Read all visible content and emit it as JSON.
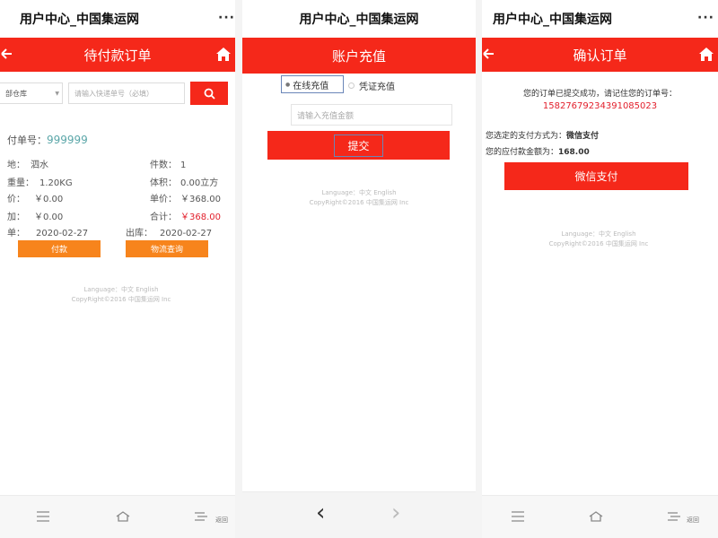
{
  "colors": {
    "brand_red": "#f5281a",
    "orange": "#f7841c",
    "order_red": "#e2202c",
    "order_teal": "#5aa6a8"
  },
  "panel1": {
    "window_title": "用户中心_中国集运网",
    "more_label": "···",
    "header": "待付款订单",
    "warehouse_select": "部仓库",
    "search_placeholder": "请输入快递单号（必填）",
    "order_label": "付单号：",
    "order_no": "999999",
    "fields": [
      {
        "label": "地：",
        "value": "泗水"
      },
      {
        "label": "件数：",
        "value": "1"
      },
      {
        "label": "重量：",
        "value": "1.20KG"
      },
      {
        "label": "体积：",
        "value": "0.00立方"
      },
      {
        "label": "价：",
        "value": "￥0.00"
      },
      {
        "label": "单价：",
        "value": "￥368.00"
      },
      {
        "label": "加：",
        "value": "￥0.00"
      },
      {
        "label": "合计：",
        "value": "￥368.00"
      },
      {
        "label": "单：",
        "value": "2020-02-27"
      },
      {
        "label": "出库：",
        "value": "2020-02-27"
      }
    ],
    "pay_button": "付款",
    "track_button": "物流查询",
    "footer_line1": "Language：中文 English",
    "footer_line2": "CopyRight©2016 中国集运网 Inc",
    "nav_back_label": "返回"
  },
  "panel2": {
    "header": "账户充值",
    "option_online": "在线充值",
    "option_voucher": "凭证充值",
    "amount_placeholder": "请输入充值金额",
    "submit_label": "提交",
    "footer_line1": "Language：中文 English",
    "footer_line2": "CopyRight©2016 中国集运网 Inc",
    "nav_prev": "‹",
    "nav_next": "›"
  },
  "panel3": {
    "window_title": "用户中心_中国集运网",
    "more_label": "···",
    "header": "确认订单",
    "success_msg": "您的订单已提交成功，请记住您的订单号：",
    "order_no": "15827679234391085023",
    "pay_method_label": "您选定的支付方式为：",
    "pay_method": "微信支付",
    "amount_label": "您的应付款金额为：",
    "amount": "168.00",
    "pay_button": "微信支付",
    "footer_line1": "Language：中文 English",
    "footer_line2": "CopyRight©2016 中国集运网 Inc",
    "nav_back_label": "返回"
  }
}
